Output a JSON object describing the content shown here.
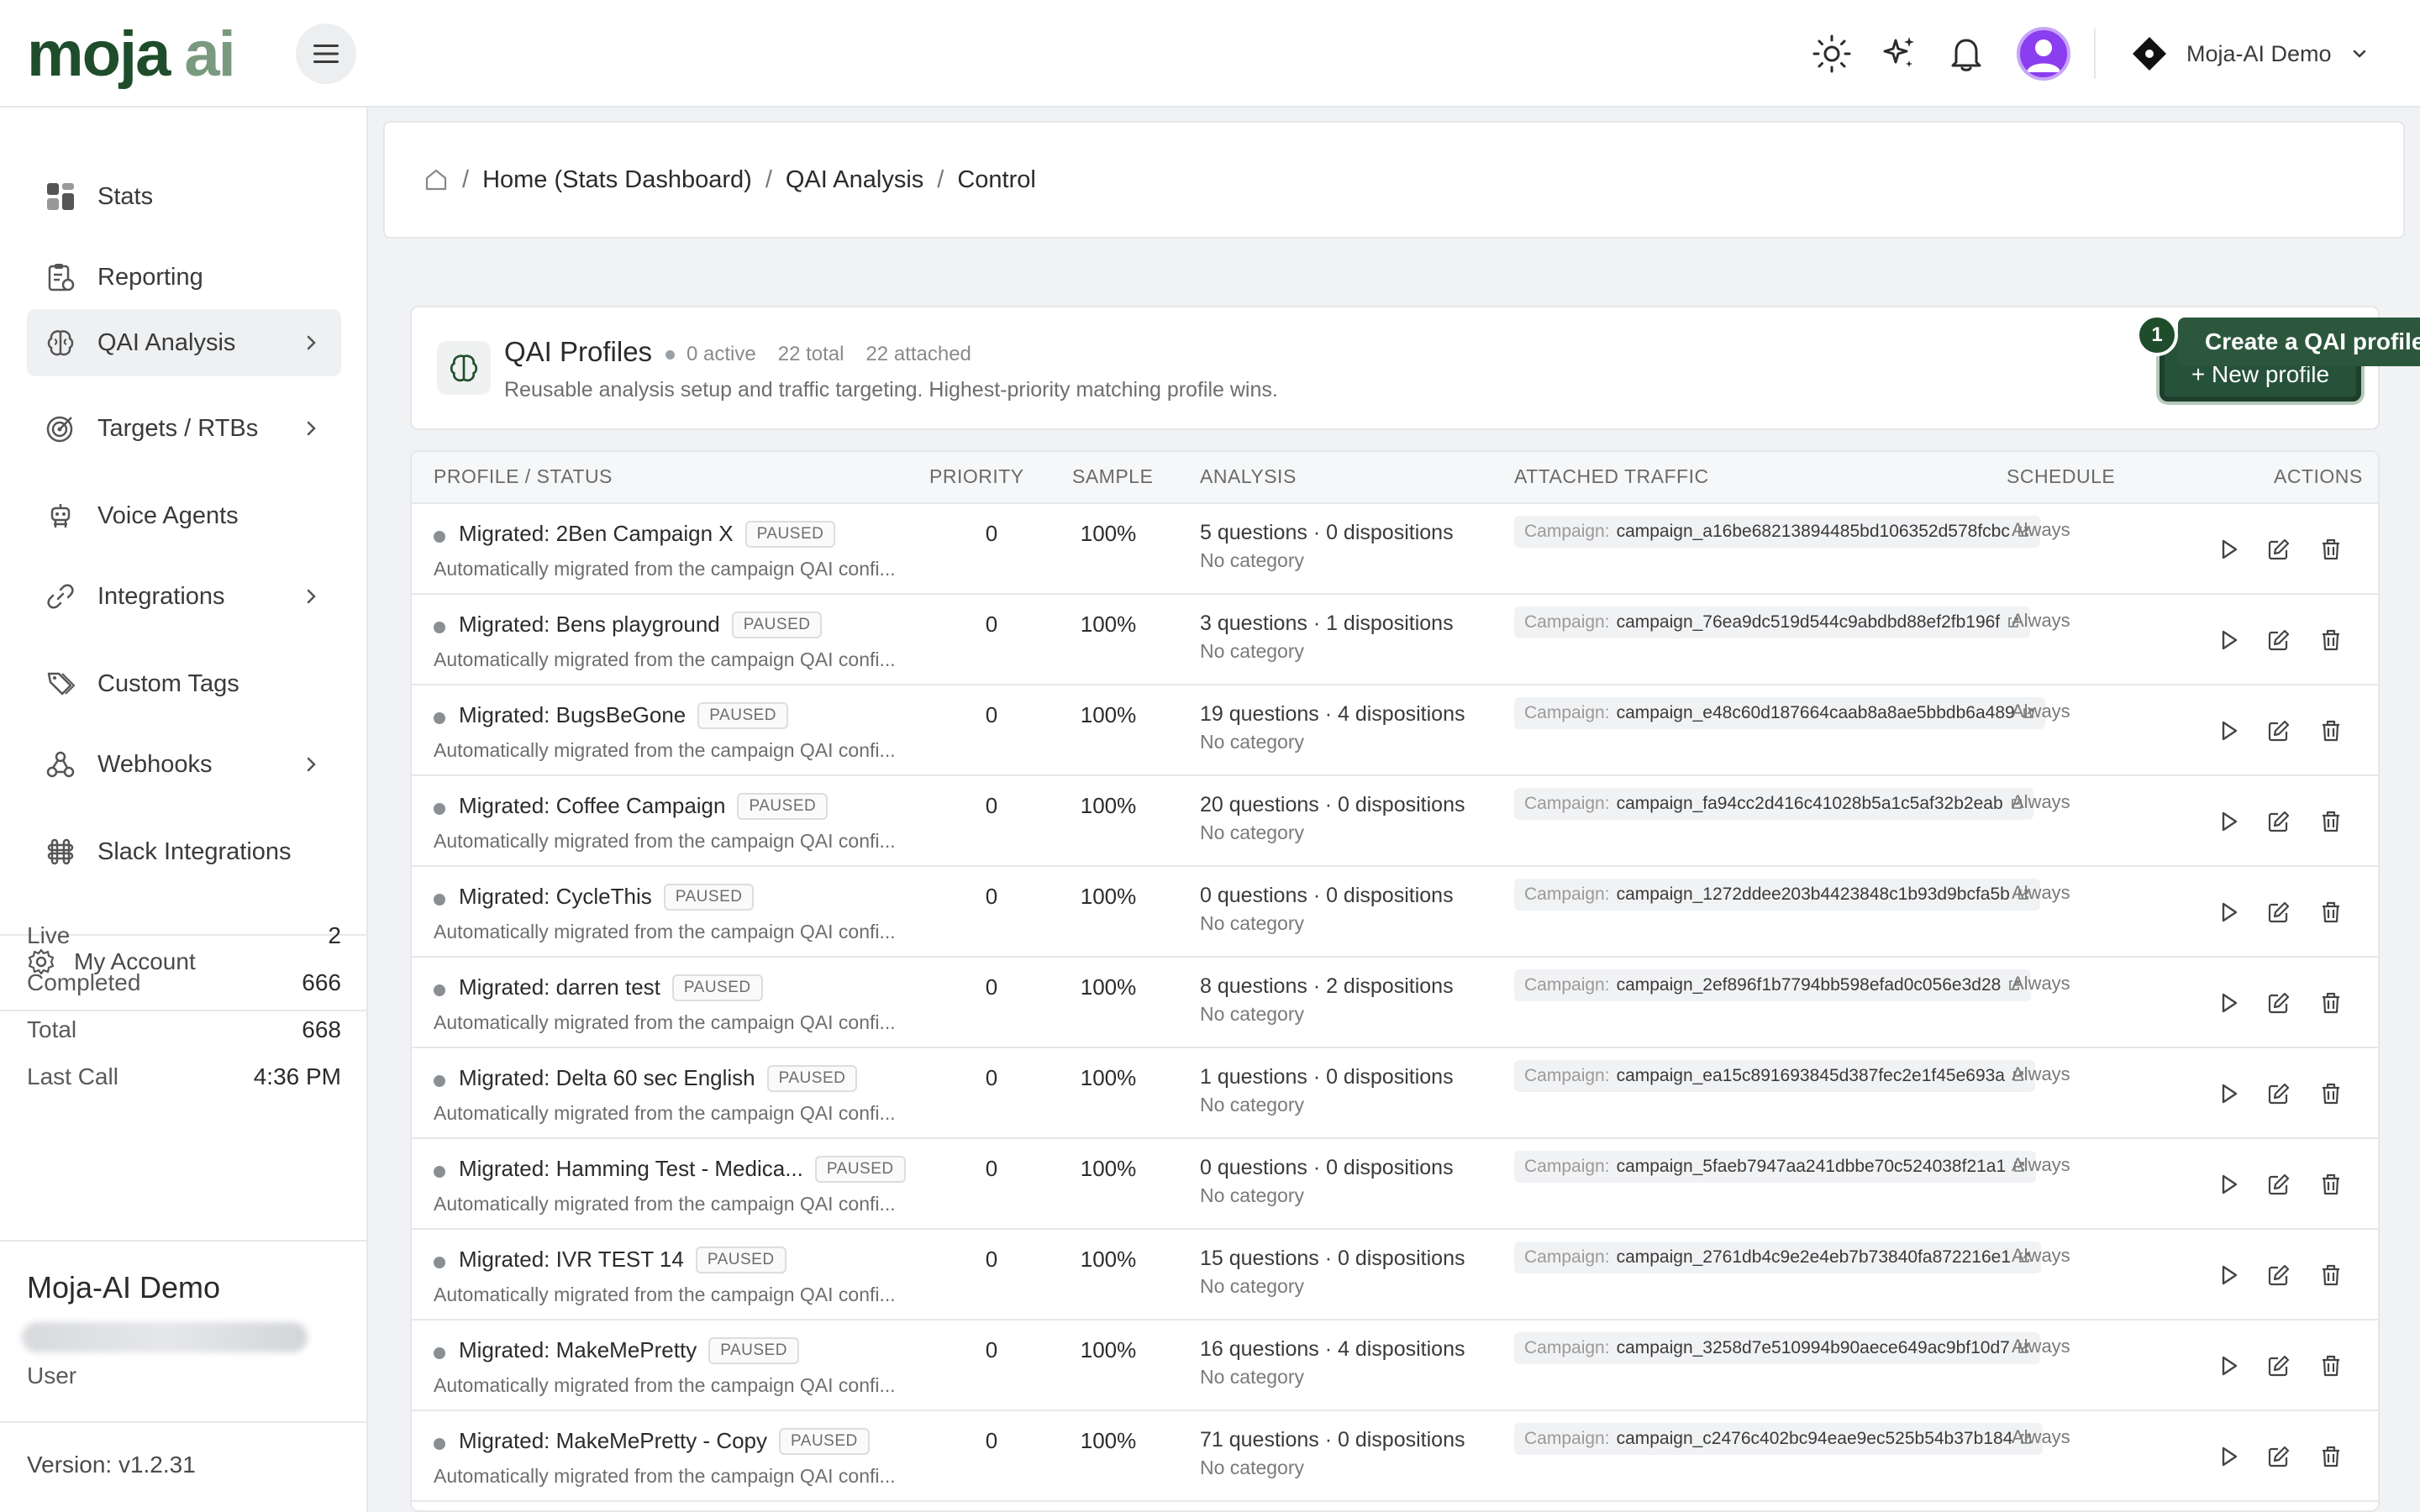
{
  "brand": {
    "logo_part1": "moja",
    "logo_part2": "ai"
  },
  "colors": {
    "brand_dark": "#1f4d2b",
    "brand_light": "#7a9a80",
    "avatar": "#8b3df0",
    "accent_button": "#27523a"
  },
  "header": {
    "org_name": "Moja-AI Demo",
    "icons": [
      "menu-icon",
      "sun-icon",
      "sparkles-icon",
      "bell-icon",
      "user-avatar",
      "chevron-down-icon"
    ]
  },
  "sidebar": {
    "items": [
      {
        "label": "Stats",
        "icon": "grid-icon",
        "has_chevron": false
      },
      {
        "label": "Reporting",
        "icon": "clipboard-icon",
        "has_chevron": false
      },
      {
        "label": "QAI Analysis",
        "icon": "brain-icon",
        "has_chevron": true
      },
      {
        "label": "Targets / RTBs",
        "icon": "target-icon",
        "has_chevron": true
      },
      {
        "label": "Voice Agents",
        "icon": "robot-icon",
        "has_chevron": false
      },
      {
        "label": "Integrations",
        "icon": "link-icon",
        "has_chevron": true
      },
      {
        "label": "Custom Tags",
        "icon": "tags-icon",
        "has_chevron": false
      },
      {
        "label": "Webhooks",
        "icon": "webhook-icon",
        "has_chevron": true
      },
      {
        "label": "Slack Integrations",
        "icon": "slack-icon",
        "has_chevron": false
      }
    ],
    "account_label": "My Account",
    "stats": [
      {
        "label": "Live",
        "value": "2"
      },
      {
        "label": "Completed",
        "value": "666"
      },
      {
        "label": "Total",
        "value": "668"
      },
      {
        "label": "Last Call",
        "value": "4:36 PM"
      }
    ],
    "org_name": "Moja-AI Demo",
    "role": "User",
    "version": "Version: v1.2.31"
  },
  "breadcrumb": {
    "items": [
      "Home (Stats Dashboard)",
      "QAI Analysis",
      "Control"
    ],
    "separator": "/"
  },
  "profiles": {
    "title": "QAI Profiles",
    "active": "0 active",
    "total": "22 total",
    "attached": "22 attached",
    "description": "Reusable analysis setup and traffic targeting. Highest-priority matching profile wins.",
    "new_button": "+ New profile",
    "tooltip_step": "1",
    "tooltip_text": "Create a QAI profile"
  },
  "table": {
    "headers": [
      "PROFILE / STATUS",
      "PRIORITY",
      "SAMPLE",
      "ANALYSIS",
      "ATTACHED TRAFFIC",
      "SCHEDULE",
      "ACTIONS"
    ],
    "rows": [
      {
        "name": "Migrated: 2Ben Campaign X",
        "status": "PAUSED",
        "desc": "Automatically migrated from the campaign QAI confi...",
        "priority": "0",
        "sample": "100%",
        "analysis": "5 questions · 0 dispositions",
        "category": "No category",
        "traffic_label": "Campaign:",
        "traffic_value": "campaign_a16be68213894485bd106352d578fcbc",
        "schedule": "Always"
      },
      {
        "name": "Migrated: Bens playground",
        "status": "PAUSED",
        "desc": "Automatically migrated from the campaign QAI confi...",
        "priority": "0",
        "sample": "100%",
        "analysis": "3 questions · 1 dispositions",
        "category": "No category",
        "traffic_label": "Campaign:",
        "traffic_value": "campaign_76ea9dc519d544c9abdbd88ef2fb196f",
        "schedule": "Always"
      },
      {
        "name": "Migrated: BugsBeGone",
        "status": "PAUSED",
        "desc": "Automatically migrated from the campaign QAI confi...",
        "priority": "0",
        "sample": "100%",
        "analysis": "19 questions · 4 dispositions",
        "category": "No category",
        "traffic_label": "Campaign:",
        "traffic_value": "campaign_e48c60d187664caab8a8ae5bbdb6a489",
        "schedule": "Always"
      },
      {
        "name": "Migrated: Coffee Campaign",
        "status": "PAUSED",
        "desc": "Automatically migrated from the campaign QAI confi...",
        "priority": "0",
        "sample": "100%",
        "analysis": "20 questions · 0 dispositions",
        "category": "No category",
        "traffic_label": "Campaign:",
        "traffic_value": "campaign_fa94cc2d416c41028b5a1c5af32b2eab",
        "schedule": "Always"
      },
      {
        "name": "Migrated: CycleThis",
        "status": "PAUSED",
        "desc": "Automatically migrated from the campaign QAI confi...",
        "priority": "0",
        "sample": "100%",
        "analysis": "0 questions · 0 dispositions",
        "category": "No category",
        "traffic_label": "Campaign:",
        "traffic_value": "campaign_1272ddee203b4423848c1b93d9bcfa5b",
        "schedule": "Always"
      },
      {
        "name": "Migrated: darren test",
        "status": "PAUSED",
        "desc": "Automatically migrated from the campaign QAI confi...",
        "priority": "0",
        "sample": "100%",
        "analysis": "8 questions · 2 dispositions",
        "category": "No category",
        "traffic_label": "Campaign:",
        "traffic_value": "campaign_2ef896f1b7794bb598efad0c056e3d28",
        "schedule": "Always"
      },
      {
        "name": "Migrated: Delta 60 sec English",
        "status": "PAUSED",
        "desc": "Automatically migrated from the campaign QAI confi...",
        "priority": "0",
        "sample": "100%",
        "analysis": "1 questions · 0 dispositions",
        "category": "No category",
        "traffic_label": "Campaign:",
        "traffic_value": "campaign_ea15c891693845d387fec2e1f45e693a",
        "schedule": "Always"
      },
      {
        "name": "Migrated: Hamming Test - Medica...",
        "status": "PAUSED",
        "desc": "Automatically migrated from the campaign QAI confi...",
        "priority": "0",
        "sample": "100%",
        "analysis": "0 questions · 0 dispositions",
        "category": "No category",
        "traffic_label": "Campaign:",
        "traffic_value": "campaign_5faeb7947aa241dbbe70c524038f21a1",
        "schedule": "Always"
      },
      {
        "name": "Migrated: IVR TEST 14",
        "status": "PAUSED",
        "desc": "Automatically migrated from the campaign QAI confi...",
        "priority": "0",
        "sample": "100%",
        "analysis": "15 questions · 0 dispositions",
        "category": "No category",
        "traffic_label": "Campaign:",
        "traffic_value": "campaign_2761db4c9e2e4eb7b73840fa872216e1",
        "schedule": "Always"
      },
      {
        "name": "Migrated: MakeMePretty",
        "status": "PAUSED",
        "desc": "Automatically migrated from the campaign QAI confi...",
        "priority": "0",
        "sample": "100%",
        "analysis": "16 questions · 4 dispositions",
        "category": "No category",
        "traffic_label": "Campaign:",
        "traffic_value": "campaign_3258d7e510994b90aece649ac9bf10d7",
        "schedule": "Always"
      },
      {
        "name": "Migrated: MakeMePretty - Copy",
        "status": "PAUSED",
        "desc": "Automatically migrated from the campaign QAI confi...",
        "priority": "0",
        "sample": "100%",
        "analysis": "71 questions · 0 dispositions",
        "category": "No category",
        "traffic_label": "Campaign:",
        "traffic_value": "campaign_c2476c402bc94eae9ec525b54b37b184",
        "schedule": "Always"
      }
    ]
  }
}
